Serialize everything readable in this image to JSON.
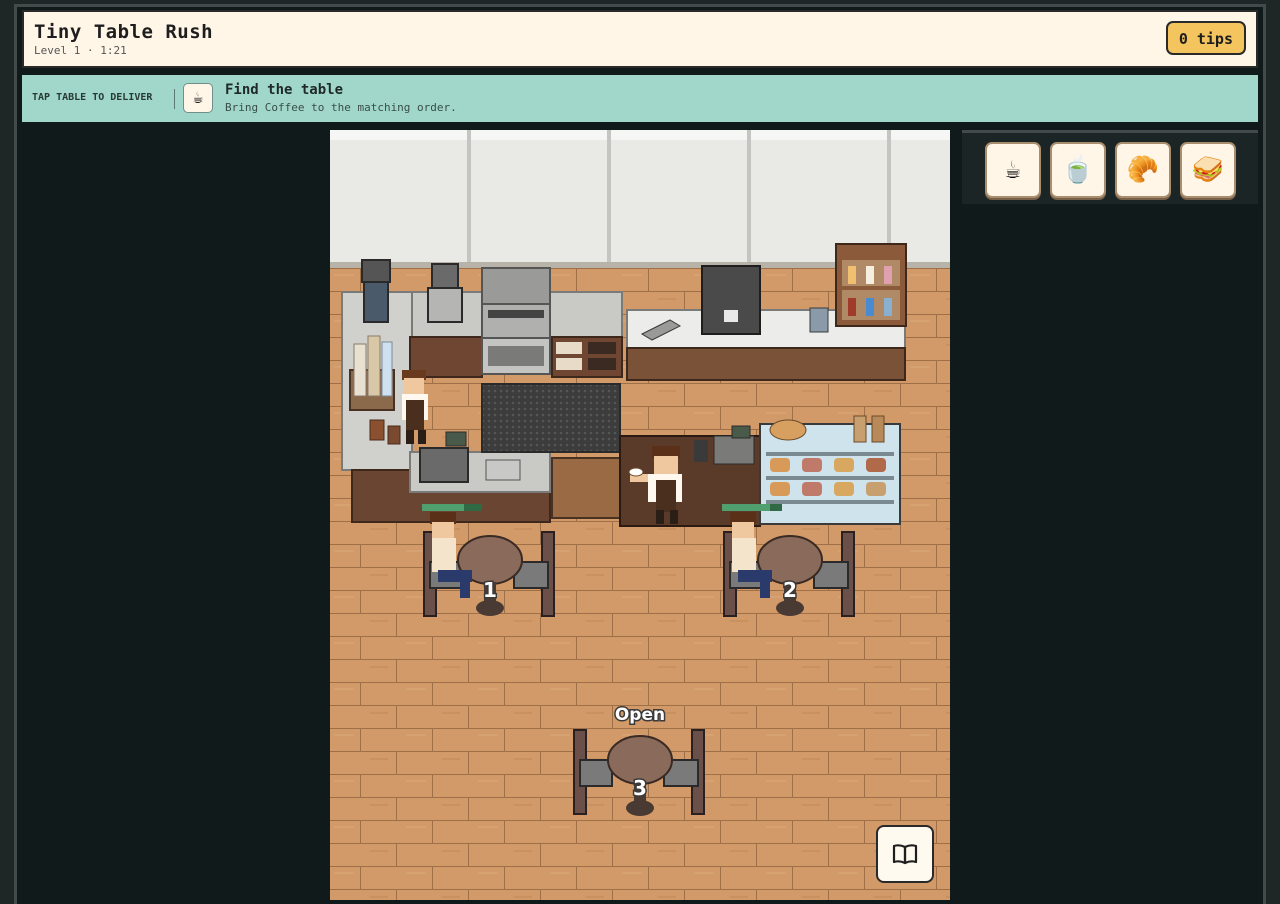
{
  "header": {
    "title": "Tiny Table Rush",
    "subtitle": "Level 1 · 1:21",
    "tips": "0 tips"
  },
  "banner": {
    "hint": "TAP TABLE TO DELIVER",
    "task_title": "Find the table",
    "task_desc": "Bring Coffee to the matching order.",
    "task_icon": "coffee-cup-icon"
  },
  "tables": [
    {
      "number": "1",
      "status": "occupied"
    },
    {
      "number": "2",
      "status": "occupied"
    },
    {
      "number": "3",
      "status": "Open"
    }
  ],
  "items": [
    {
      "name": "coffee-icon",
      "glyph": "☕"
    },
    {
      "name": "tea-icon",
      "glyph": "🍵"
    },
    {
      "name": "croissant-icon",
      "glyph": "🥐"
    },
    {
      "name": "sandwich-icon",
      "glyph": "🥪"
    }
  ],
  "colors": {
    "banner": "#a0d7ca",
    "tips": "#f4c55e",
    "floor": "#d19a68",
    "patience_bar": "#4fa06e"
  }
}
